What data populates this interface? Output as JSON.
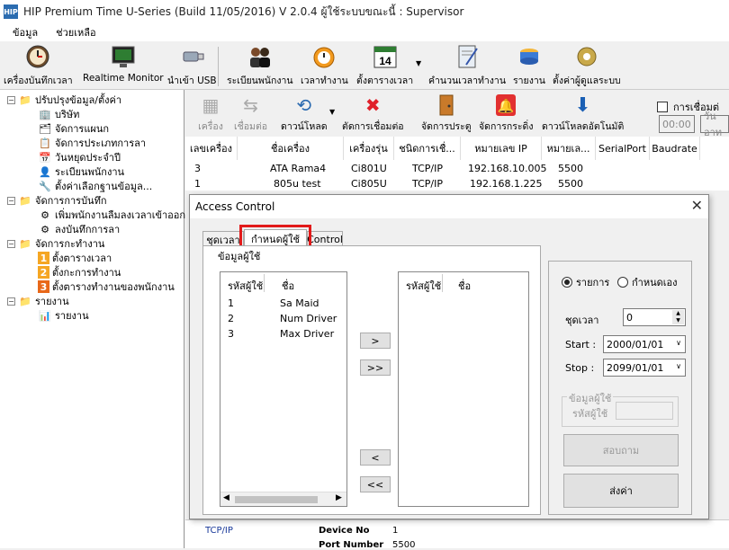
{
  "window": {
    "title": "HIP Premium Time U-Series (Build 11/05/2016) V 2.0.4    ผู้ใช้ระบบขณะนี้ : Supervisor",
    "app_icon": "HIP"
  },
  "menu": [
    "ข้อมูล",
    "ช่วยเหลือ"
  ],
  "toolbar": [
    {
      "label": "เครื่องบันทึกเวลา",
      "icon": "clock-icon"
    },
    {
      "label": "Realtime Monitor",
      "icon": "monitor-icon"
    },
    {
      "label": "นำเข้า USB",
      "icon": "usb-icon"
    },
    {
      "label": "ระเบียนพนักงาน",
      "icon": "users-icon"
    },
    {
      "label": "เวลาทำงาน",
      "icon": "alarm-icon"
    },
    {
      "label": "ตั้งตารางเวลา",
      "icon": "calendar-icon",
      "calendar_day": "14"
    },
    {
      "label": "คำนวนเวลาทำงาน",
      "icon": "calculate-icon"
    },
    {
      "label": "รายงาน",
      "icon": "report-icon"
    },
    {
      "label": "ตั้งค่าผู้ดูแลระบบ",
      "icon": "admin-icon"
    }
  ],
  "tree": [
    {
      "label": "ปรับปรุงข้อมูล/ตั้งค่า",
      "level": 0
    },
    {
      "label": "บริษัท",
      "level": 1
    },
    {
      "label": "จัดการแผนก",
      "level": 1
    },
    {
      "label": "จัดการประเภทการลา",
      "level": 1
    },
    {
      "label": "วันหยุดประจำปี",
      "level": 1
    },
    {
      "label": "ระเบียนพนักงาน",
      "level": 1
    },
    {
      "label": "ตั้งค่าเลือกฐานข้อมูล...",
      "level": 1
    },
    {
      "label": "จัดการการบันทึก",
      "level": 0
    },
    {
      "label": "เพิ่มพนักงานลืมลงเวลาเข้าออก",
      "level": 1
    },
    {
      "label": "ลงบันทึกการลา",
      "level": 1
    },
    {
      "label": "จัดการกะทำงาน",
      "level": 0
    },
    {
      "label": "ตั้งตารางเวลา",
      "level": 1,
      "badge": "1"
    },
    {
      "label": "ตั้งกะการทำงาน",
      "level": 1,
      "badge": "2"
    },
    {
      "label": "ตั้งตารางทำงานของพนักงาน",
      "level": 1,
      "badge": "3"
    },
    {
      "label": "รายงาน",
      "level": 0
    },
    {
      "label": "รายงาน",
      "level": 1
    }
  ],
  "device_toolbar": [
    {
      "label": "เครื่อง"
    },
    {
      "label": "เชื่อมต่อ"
    },
    {
      "label": "ดาวน์โหลด"
    },
    {
      "label": "ตัดการเชื่อมต่อ"
    },
    {
      "label": "จัดการประตู"
    },
    {
      "label": "จัดการกระดิ่ง"
    },
    {
      "label": "ดาวน์โหลดอัตโนมัติ"
    }
  ],
  "auto_connect": {
    "label": "การเชื่อมต่",
    "time": "00:00",
    "day_label": "วันอาท"
  },
  "device_grid": {
    "columns": [
      "เลขเครื่อง",
      "ชื่อเครื่อง",
      "เครื่องรุ่น",
      "ชนิดการเชื่...",
      "หมายเลข IP",
      "หมายเล...",
      "SerialPort",
      "Baudrate"
    ],
    "rows": [
      [
        "3",
        "ATA Rama4",
        "Ci801U",
        "TCP/IP",
        "192.168.10.005",
        "5500",
        "",
        ""
      ],
      [
        "1",
        "805u test",
        "Ci805U",
        "TCP/IP",
        "192.168.1.225",
        "5500",
        "",
        ""
      ]
    ]
  },
  "background_fragments": {
    "tcp": "TCP/IP",
    "device_no": "Device No",
    "device_no_val": "1",
    "port": "Port Number",
    "port_val": "5500"
  },
  "dialog": {
    "title": "Access Control",
    "tabs": [
      "ชุดเวลา",
      "กำหนดผู้ใช้",
      "Control"
    ],
    "user_group": "ข้อมูลผู้ใช้",
    "left_headers": [
      "รหัสผู้ใช้",
      "ชื่อ"
    ],
    "left_rows": [
      [
        "1",
        "Sa Maid"
      ],
      [
        "2",
        "Num Driver"
      ],
      [
        "3",
        "Max Driver"
      ]
    ],
    "right_headers": [
      "รหัสผู้ใช้",
      "ชื่อ"
    ],
    "buttons": {
      "add": ">",
      "add_all": ">>",
      "remove": "<",
      "remove_all": "<<"
    },
    "radio_list": "รายการ",
    "radio_custom": "กำหนดเอง",
    "timeset_label": "ชุดเวลา",
    "timeset_value": "0",
    "start_label": "Start :",
    "start_value": "2000/01/01",
    "stop_label": "Stop :",
    "stop_value": "2099/01/01",
    "user_info_group": "ข้อมูลผู้ใช้",
    "user_id_label": "รหัสผู้ใช้",
    "query_button": "สอบถาม",
    "send_button": "ส่งค่า"
  }
}
